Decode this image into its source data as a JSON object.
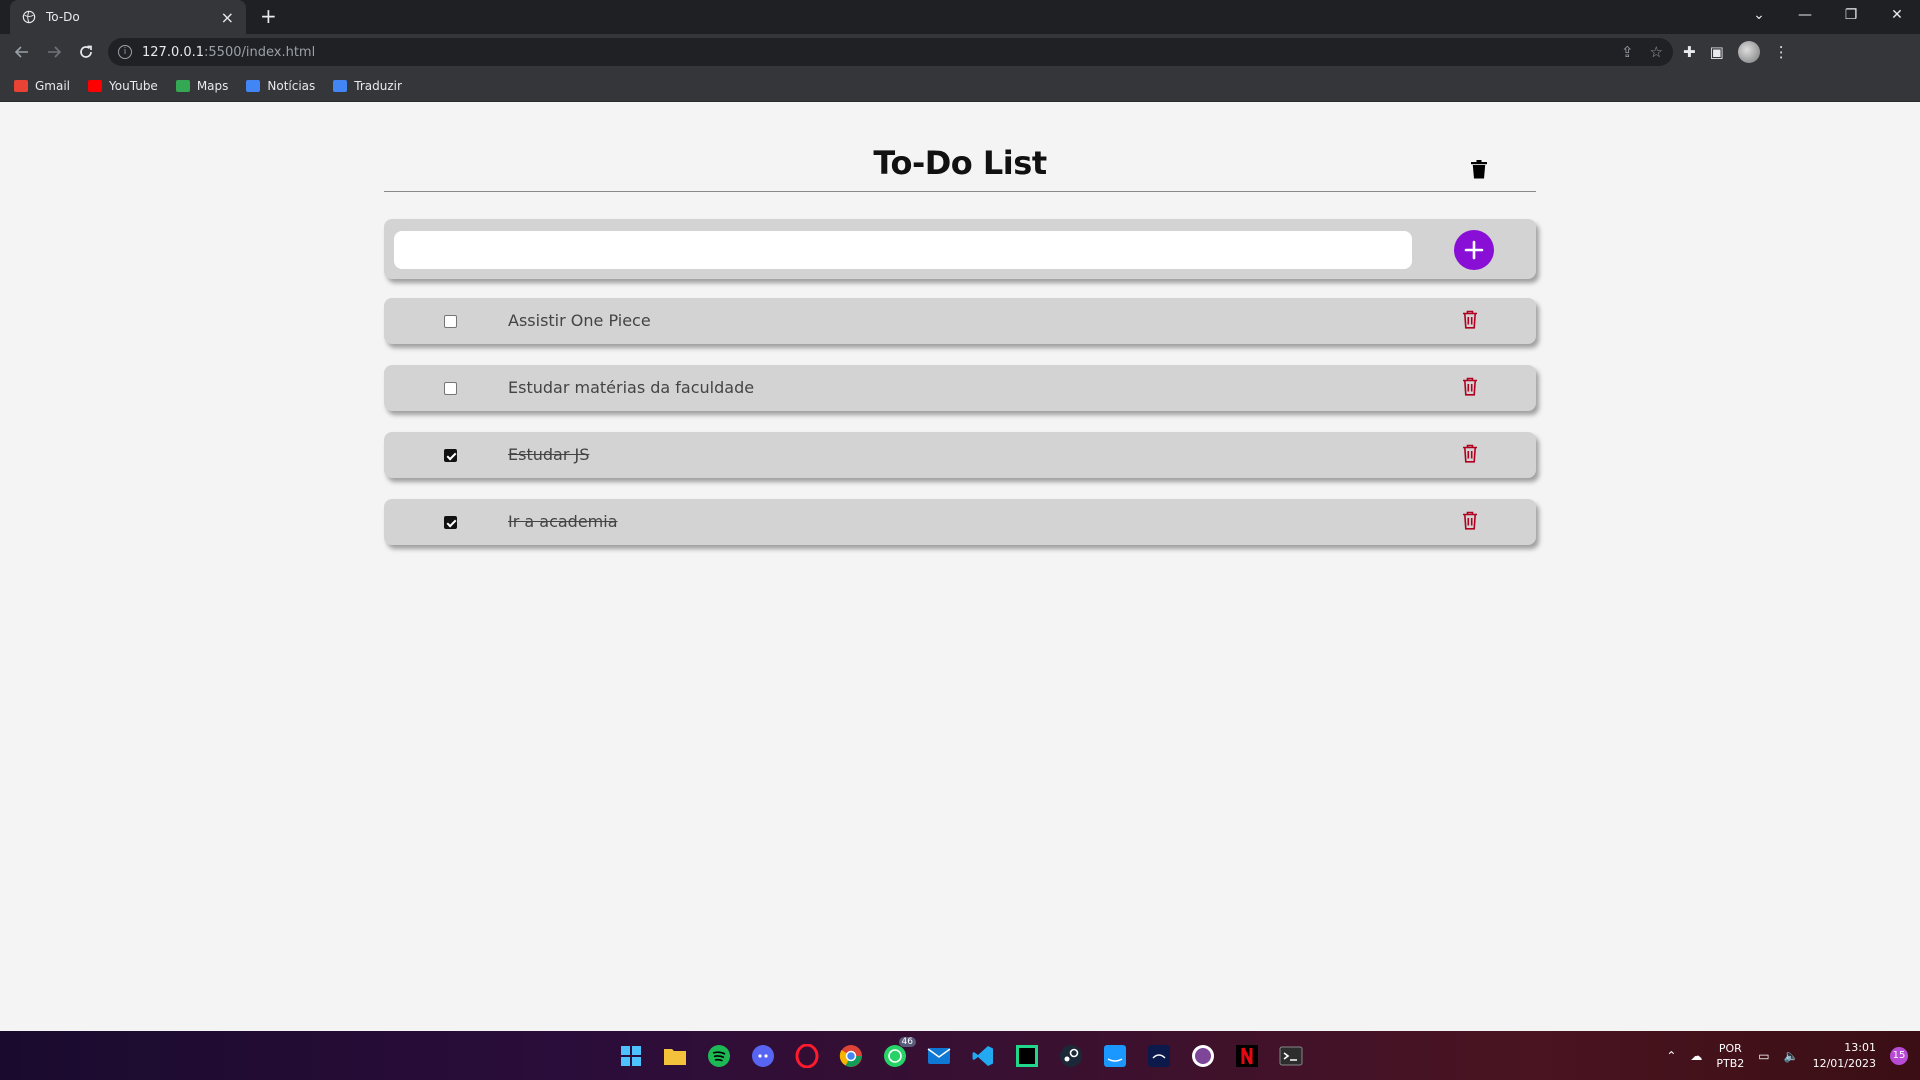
{
  "browser": {
    "tab_title": "To-Do",
    "tab_close": "×",
    "new_tab": "+",
    "url_host": "127.0.0.1",
    "url_path": ":5500/index.html",
    "window_controls": {
      "dropdown": "⌄",
      "minimize": "—",
      "restore": "❐",
      "close": "✕"
    },
    "bookmarks": [
      {
        "label": "Gmail",
        "color": "#ea4335"
      },
      {
        "label": "YouTube",
        "color": "#ff0000"
      },
      {
        "label": "Maps",
        "color": "#34a853"
      },
      {
        "label": "Notícias",
        "color": "#4285f4"
      },
      {
        "label": "Traduzir",
        "color": "#4285f4"
      }
    ]
  },
  "app": {
    "title": "To-Do List",
    "input_value": "",
    "accent_color": "#8a0fd6",
    "delete_color": "#b00020",
    "tasks": [
      {
        "text": "Assistir One Piece",
        "done": false
      },
      {
        "text": "Estudar matérias da faculdade",
        "done": false
      },
      {
        "text": "Estudar JS",
        "done": true
      },
      {
        "text": "Ir a academia",
        "done": true
      }
    ]
  },
  "taskbar": {
    "whatsapp_badge": "46",
    "language": "POR",
    "layout": "PTB2",
    "time": "13:01",
    "date": "12/01/2023",
    "notifications": "15"
  }
}
